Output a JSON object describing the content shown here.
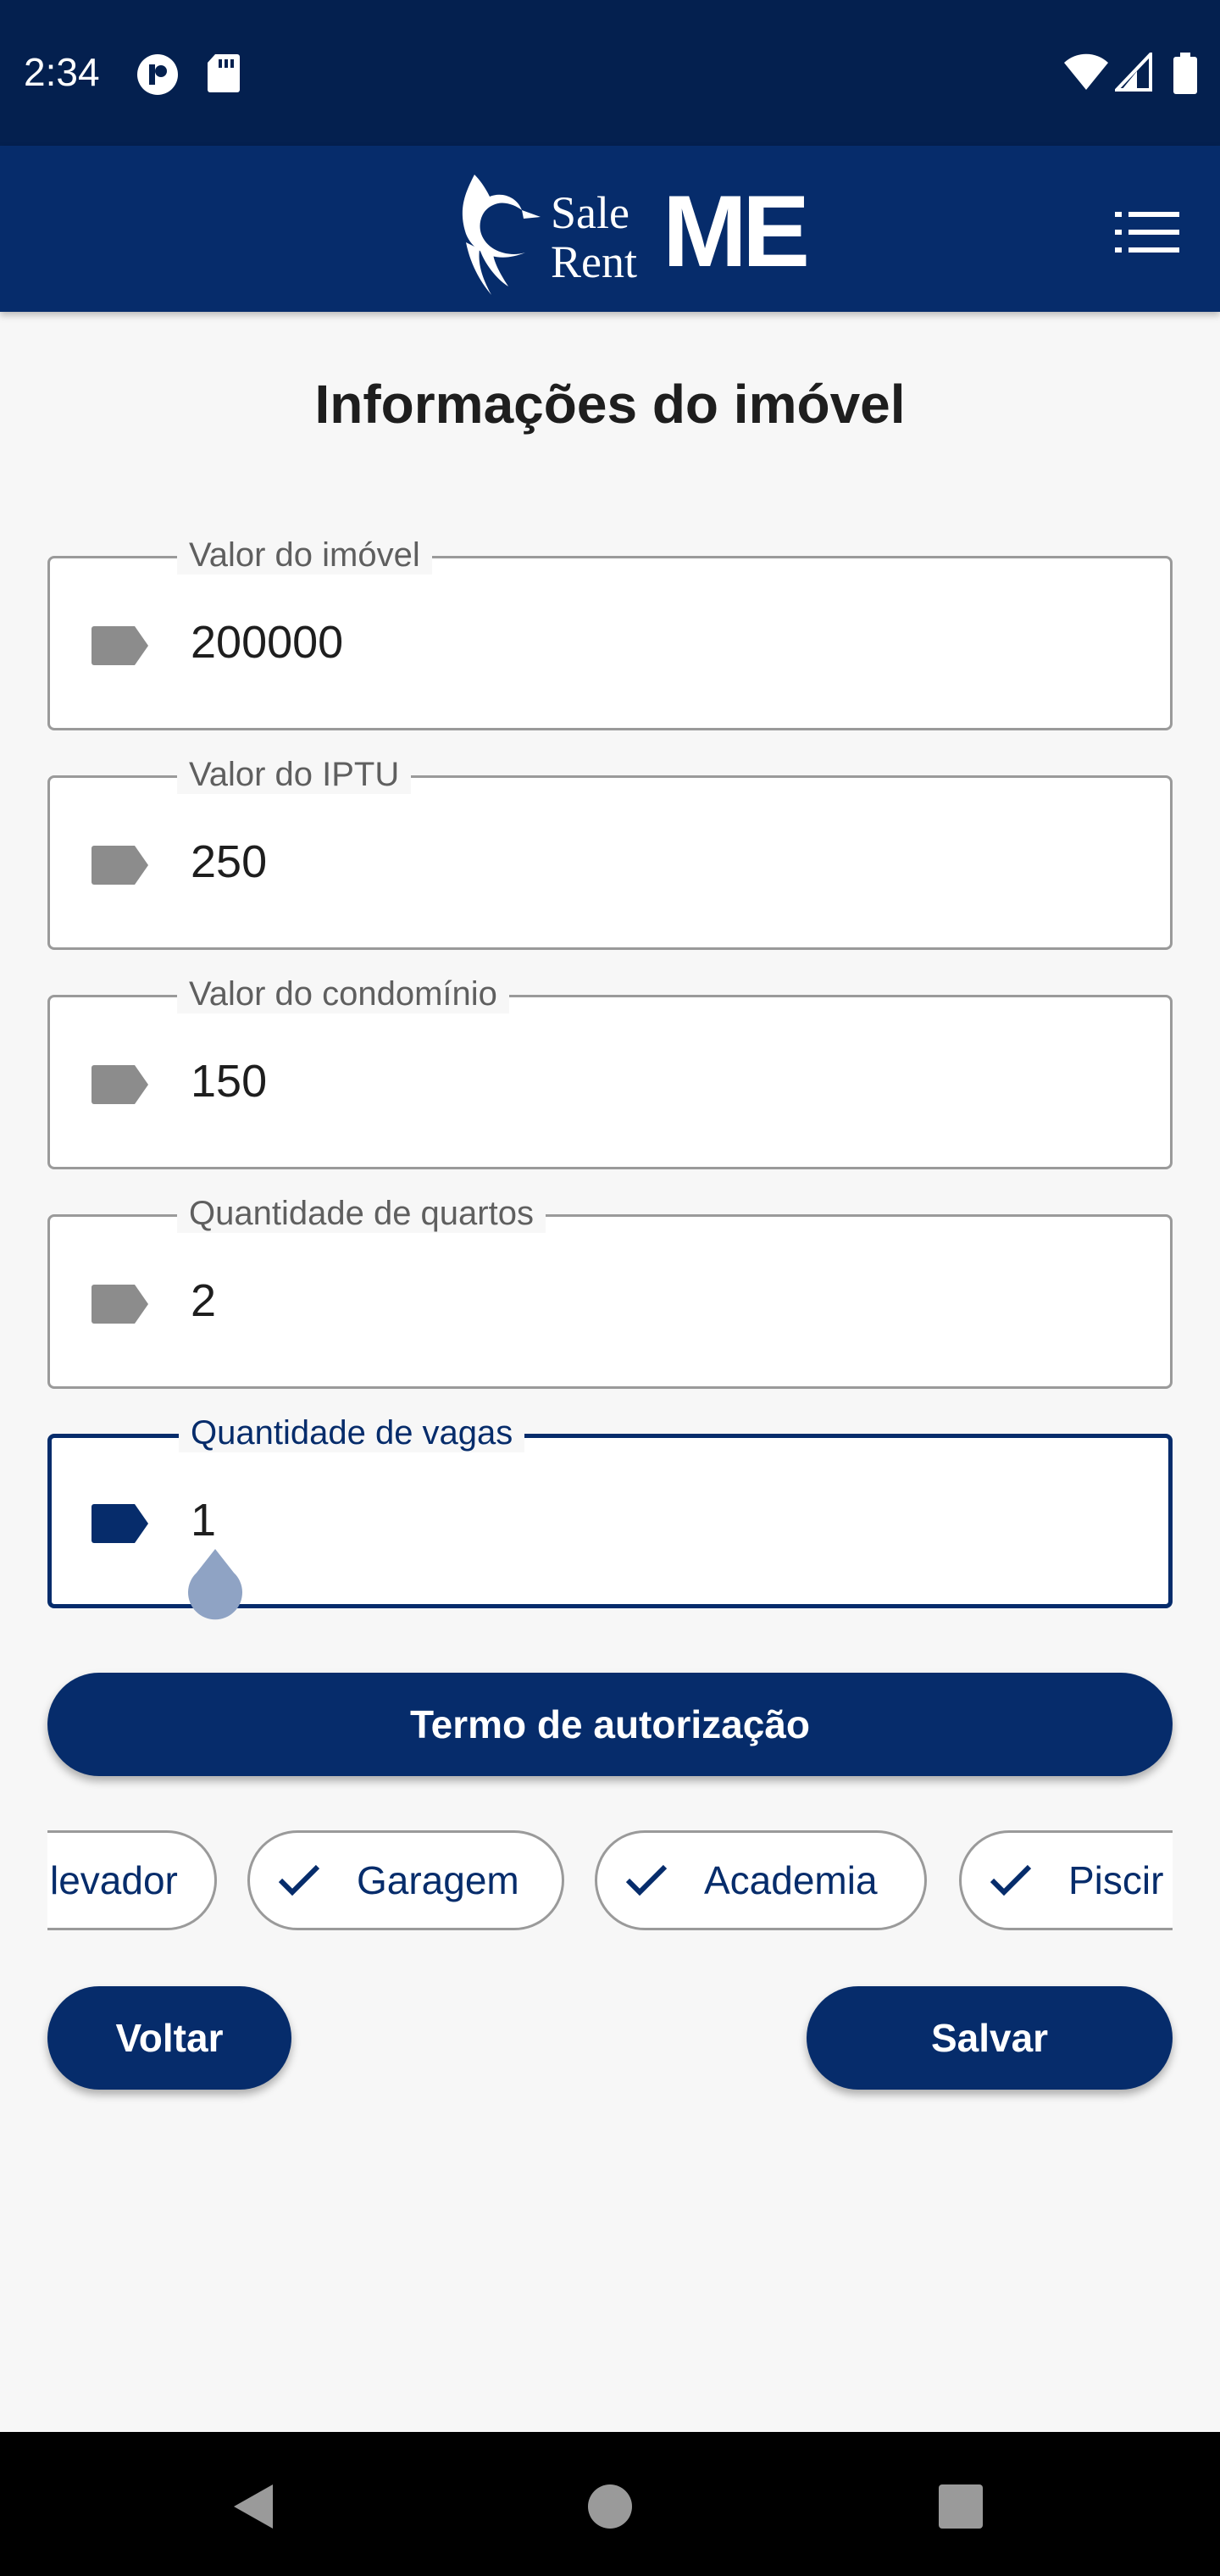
{
  "status_bar": {
    "time": "2:34",
    "icons": [
      "notification-app-icon",
      "sd-card-icon",
      "wifi-icon",
      "signal-icon",
      "battery-icon"
    ]
  },
  "app_bar": {
    "logo_words": [
      "Sale",
      "Rent",
      "ME"
    ],
    "menu_icon": "list-menu-icon",
    "color": "#062c6b"
  },
  "page": {
    "title": "Informações do imóvel"
  },
  "fields": [
    {
      "label": "Valor do imóvel",
      "value": "200000",
      "icon": "tag-icon",
      "active": false
    },
    {
      "label": "Valor do IPTU",
      "value": "250",
      "icon": "tag-icon",
      "active": false
    },
    {
      "label": "Valor do condomínio",
      "value": "150",
      "icon": "tag-icon",
      "active": false
    },
    {
      "label": "Quantidade de quartos",
      "value": "2",
      "icon": "tag-icon",
      "active": false
    },
    {
      "label": "Quantidade de vagas",
      "value": "1",
      "icon": "tag-icon",
      "active": true
    }
  ],
  "authorization_button": {
    "label": "Termo de autorização"
  },
  "amenities": [
    {
      "label": "levador",
      "checked": false
    },
    {
      "label": "Garagem",
      "checked": true
    },
    {
      "label": "Academia",
      "checked": true
    },
    {
      "label": "Piscir",
      "checked": true
    }
  ],
  "actions": {
    "back_label": "Voltar",
    "save_label": "Salvar"
  },
  "colors": {
    "primary": "#062c6b",
    "status_bar": "#04204f",
    "inactive_icon": "#8c8c8c"
  }
}
